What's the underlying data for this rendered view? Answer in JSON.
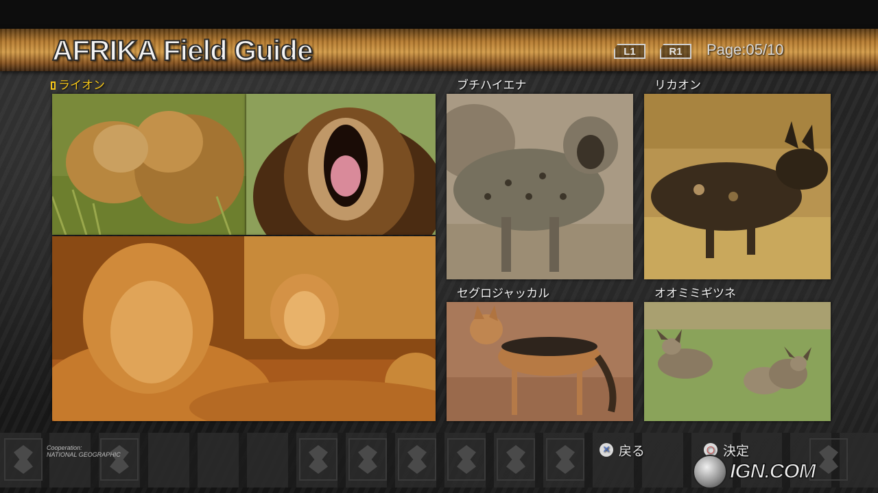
{
  "header": {
    "title": "AFRIKA Field Guide",
    "nav_prev": "L1",
    "nav_next": "R1",
    "page_indicator": "Page:05/10"
  },
  "entries": [
    {
      "id": "lion",
      "label": "ライオン",
      "selected": true
    },
    {
      "id": "spotted-hyena",
      "label": "ブチハイエナ",
      "selected": false
    },
    {
      "id": "african-wild-dog",
      "label": "リカオン",
      "selected": false
    },
    {
      "id": "black-backed-jackal",
      "label": "セグロジャッカル",
      "selected": false
    },
    {
      "id": "bat-eared-fox",
      "label": "オオミミギツネ",
      "selected": false
    }
  ],
  "footer": {
    "credit_line1": "Cooperation:",
    "credit_line2": "NATIONAL GEOGRAPHIC",
    "back_button_icon": "cross-button-icon",
    "back_label": "戻る",
    "confirm_button_icon": "circle-button-icon",
    "confirm_label": "決定"
  },
  "watermark": {
    "text": "IGN.COM"
  },
  "colors": {
    "selected_text": "#f5c518",
    "banner": "#b57a2e",
    "text": "#f2f2f2"
  }
}
